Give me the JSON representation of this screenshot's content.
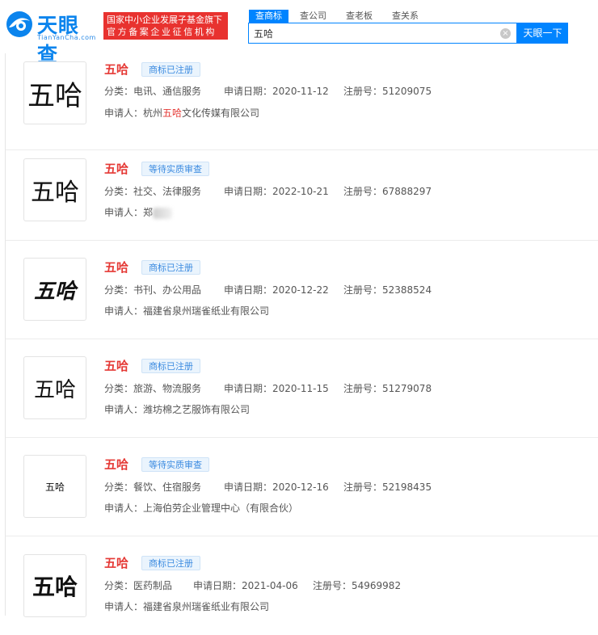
{
  "logo": {
    "name": "天眼查",
    "sub": "TianYanCha.com"
  },
  "slogan": {
    "line1": "国家中小企业发展子基金旗下",
    "line2": "官方备案企业征信机构"
  },
  "tabs": [
    "查商标",
    "查公司",
    "查老板",
    "查关系"
  ],
  "search": {
    "value": "五哈",
    "button": "天眼一下",
    "clear": "×"
  },
  "results": [
    {
      "name": "五哈",
      "status": "商标已注册",
      "category": "分类：电讯、通信服务",
      "date": "申请日期：2020-11-12",
      "reg_no": "注册号：51209075",
      "applicant_prefix": "申请人：杭州",
      "applicant_hl": "五哈",
      "applicant_suffix": "文化传媒有限公司",
      "logo_text": "五哈"
    },
    {
      "name": "五哈",
      "status": "等待实质审查",
      "category": "分类：社交、法律服务",
      "date": "申请日期：2022-10-21",
      "reg_no": "注册号：67888297",
      "applicant_prefix": "申请人：郑",
      "applicant_hl": "",
      "applicant_suffix": "",
      "logo_text": "五哈"
    },
    {
      "name": "五哈",
      "status": "商标已注册",
      "category": "分类：书刊、办公用品",
      "date": "申请日期：2020-12-22",
      "reg_no": "注册号：52388524",
      "applicant_prefix": "申请人：福建省泉州瑞雀纸业有限公司",
      "applicant_hl": "",
      "applicant_suffix": "",
      "logo_text": "五哈"
    },
    {
      "name": "五哈",
      "status": "商标已注册",
      "category": "分类：旅游、物流服务",
      "date": "申请日期：2020-11-15",
      "reg_no": "注册号：51279078",
      "applicant_prefix": "申请人：潍坊棉之艺服饰有限公司",
      "applicant_hl": "",
      "applicant_suffix": "",
      "logo_text": "五哈"
    },
    {
      "name": "五哈",
      "status": "等待实质审查",
      "category": "分类：餐饮、住宿服务",
      "date": "申请日期：2020-12-16",
      "reg_no": "注册号：52198435",
      "applicant_prefix": "申请人：上海伯劳企业管理中心（有限合伙）",
      "applicant_hl": "",
      "applicant_suffix": "",
      "logo_text": "五哈"
    },
    {
      "name": "五哈",
      "status": "商标已注册",
      "category": "分类：医药制品",
      "date": "申请日期：2021-04-06",
      "reg_no": "注册号：54969982",
      "applicant_prefix": "申请人：福建省泉州瑞雀纸业有限公司",
      "applicant_hl": "",
      "applicant_suffix": "",
      "logo_text": "五哈"
    }
  ]
}
